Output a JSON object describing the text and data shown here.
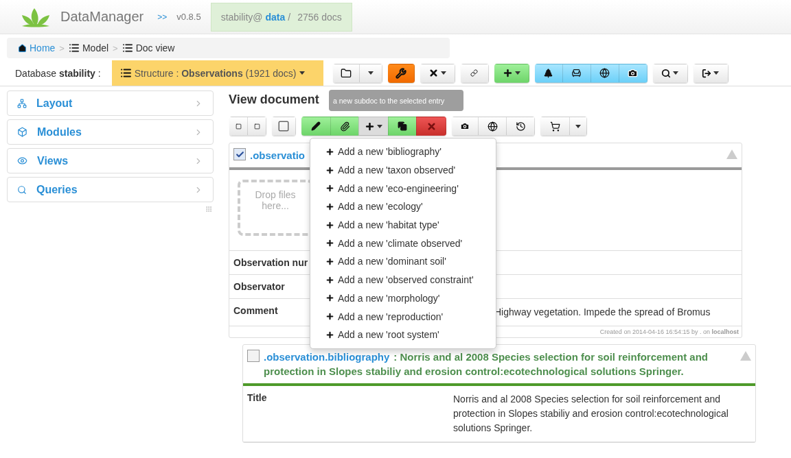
{
  "header": {
    "app_name": "DataManager",
    "nav_toggle": ">>",
    "version": "v0.8.5",
    "db_badge": {
      "user": "stability@",
      "db": "data",
      "separator": "/",
      "count": "2756 docs"
    }
  },
  "breadcrumb": {
    "separator": ">",
    "items": [
      {
        "label": "Home"
      },
      {
        "label": "Model"
      },
      {
        "label": "Doc view"
      }
    ]
  },
  "toolbar": {
    "database_label": "Database",
    "database_name": "stability",
    "database_suffix": ":",
    "structure": {
      "prefix": "Structure :",
      "name": "Observations",
      "count": "(1921 docs)"
    }
  },
  "sidebar": {
    "items": [
      {
        "label": "Layout"
      },
      {
        "label": "Modules"
      },
      {
        "label": "Views"
      },
      {
        "label": "Queries"
      }
    ]
  },
  "main": {
    "title": "View document",
    "tooltip": "a new subdoc to the selected entry",
    "add_menu": {
      "open": true,
      "items": [
        {
          "label": "Add a new 'bibliography'"
        },
        {
          "label": "Add a new 'taxon observed'"
        },
        {
          "label": "Add a new 'eco-engineering'"
        },
        {
          "label": "Add a new 'ecology'"
        },
        {
          "label": "Add a new 'habitat type'"
        },
        {
          "label": "Add a new 'climate observed'"
        },
        {
          "label": "Add a new 'dominant soil'"
        },
        {
          "label": "Add a new 'observed constraint'"
        },
        {
          "label": "Add a new 'morphology'"
        },
        {
          "label": "Add a new 'reproduction'"
        },
        {
          "label": "Add a new 'root system'"
        }
      ]
    },
    "documents": [
      {
        "checked": true,
        "type": ".observatio",
        "color": "#9a9a9a",
        "drop_zone": "Drop files here...",
        "fields": [
          {
            "label": "Observation nur"
          },
          {
            "label": "Observator"
          },
          {
            "label": "Comment",
            "value": "Highway vegetation. Impede the spread of Bromus"
          }
        ],
        "footer": "Created on 2014-04-16 16:54:15 by . on **localhost**"
      },
      {
        "checked": false,
        "type": ".observation.bibliography",
        "title": ": Norris and al 2008 Species selection for soil reinforcement and protection in Slopes stabiliy and erosion control:ecotechnological solutions Springer.",
        "color": "#4e9a2a",
        "fields": [
          {
            "label": "Title",
            "value": "Norris and al 2008 Species selection for soil reinforcement and protection in Slopes stabiliy and erosion control:ecotechnological solutions Springer."
          }
        ]
      }
    ]
  }
}
